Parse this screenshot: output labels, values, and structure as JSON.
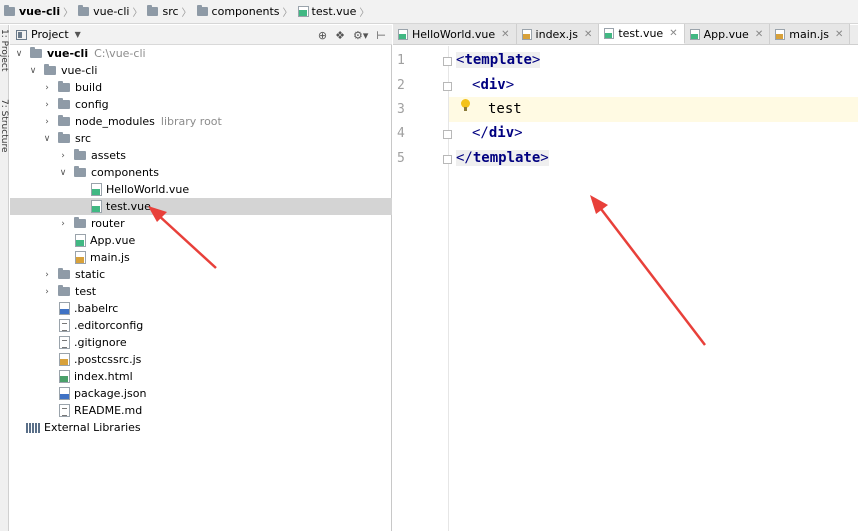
{
  "breadcrumb": {
    "items": [
      "vue-cli",
      "vue-cli",
      "src",
      "components",
      "test.vue"
    ]
  },
  "toolstrip": {
    "labels": [
      "1: Project",
      "7: Structure"
    ]
  },
  "project_panel": {
    "title": "Project",
    "tool_icons": [
      "target-icon",
      "split-icon",
      "gear-icon",
      "collapse-icon"
    ]
  },
  "tree": {
    "root_name": "vue-cli",
    "root_path": "C:\\vue-cli",
    "items": [
      {
        "label": "vue-cli",
        "type": "folder"
      },
      {
        "label": "build",
        "type": "folder"
      },
      {
        "label": "config",
        "type": "folder"
      },
      {
        "label": "node_modules",
        "type": "folder",
        "hint": "library root"
      },
      {
        "label": "src",
        "type": "folder"
      },
      {
        "label": "assets",
        "type": "folder"
      },
      {
        "label": "components",
        "type": "folder"
      },
      {
        "label": "HelloWorld.vue",
        "type": "vue"
      },
      {
        "label": "test.vue",
        "type": "vue"
      },
      {
        "label": "router",
        "type": "folder"
      },
      {
        "label": "App.vue",
        "type": "vue"
      },
      {
        "label": "main.js",
        "type": "js"
      },
      {
        "label": "static",
        "type": "folder"
      },
      {
        "label": "test",
        "type": "folder"
      },
      {
        "label": ".babelrc",
        "type": "json"
      },
      {
        "label": ".editorconfig",
        "type": "txt"
      },
      {
        "label": ".gitignore",
        "type": "txt"
      },
      {
        "label": ".postcssrc.js",
        "type": "js"
      },
      {
        "label": "index.html",
        "type": "html"
      },
      {
        "label": "package.json",
        "type": "json"
      },
      {
        "label": "README.md",
        "type": "txt"
      },
      {
        "label": "External Libraries",
        "type": "library"
      }
    ],
    "selected": "test.vue"
  },
  "tabs": [
    {
      "label": "HelloWorld.vue",
      "icon": "vue"
    },
    {
      "label": "index.js",
      "icon": "js"
    },
    {
      "label": "test.vue",
      "icon": "vue",
      "active": true
    },
    {
      "label": "App.vue",
      "icon": "vue"
    },
    {
      "label": "main.js",
      "icon": "js"
    }
  ],
  "editor": {
    "line_numbers": [
      "1",
      "2",
      "3",
      "4",
      "5"
    ],
    "lines": [
      {
        "open": "<",
        "tag": "template",
        "close": ">"
      },
      {
        "open": "<",
        "tag": "div",
        "close": ">"
      },
      {
        "text": "test"
      },
      {
        "open": "</",
        "tag": "div",
        "close": ">"
      },
      {
        "open": "</",
        "tag": "template",
        "close": ">"
      }
    ]
  },
  "colors": {
    "annotation_arrow": "#e8403a",
    "selection": "#d4d4d4",
    "caret_line": "#fffae3",
    "tag": "#000080"
  }
}
